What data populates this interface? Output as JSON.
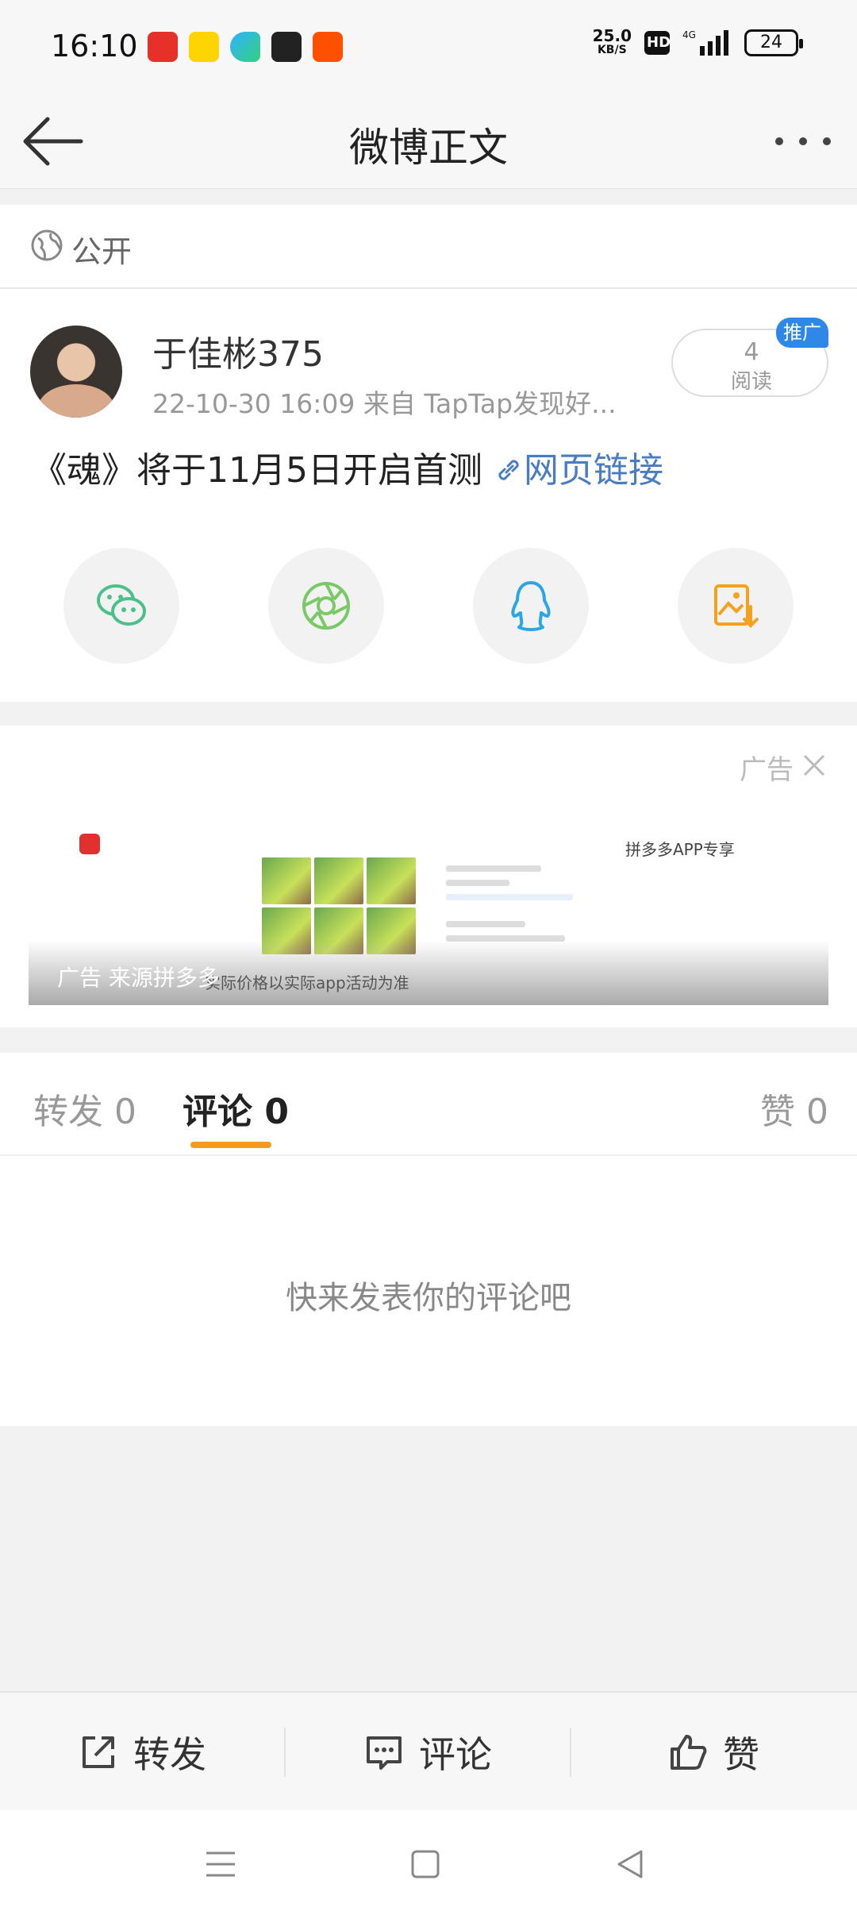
{
  "status_bar": {
    "time": "16:10",
    "net_speed_value": "25.0",
    "net_speed_unit": "KB/S",
    "hd": "HD",
    "signal": "4G",
    "battery": "24",
    "app_icons": [
      {
        "name": "toutiao-icon",
        "color": "#e6312b"
      },
      {
        "name": "yy-icon",
        "color": "#ffd400"
      },
      {
        "name": "video-icon",
        "color": "#2fb2ff"
      },
      {
        "name": "news-icon",
        "color": "#222222"
      },
      {
        "name": "taobao-icon",
        "color": "#ff5000"
      }
    ]
  },
  "nav": {
    "title": "微博正文"
  },
  "visibility": {
    "label": "公开"
  },
  "post": {
    "username": "于佳彬375",
    "meta": "22-10-30 16:09   来自 TapTap发现好...",
    "read_count": "4",
    "read_label": "阅读",
    "promo_badge": "推广",
    "text": "《魂》将于11月5日开启首测",
    "link_text": "网页链接"
  },
  "share": [
    {
      "name": "wechat-share-button",
      "color": "#4bc08a"
    },
    {
      "name": "moments-share-button",
      "color": "#79c966"
    },
    {
      "name": "qq-share-button",
      "color": "#2aa6e6"
    },
    {
      "name": "save-image-button",
      "color": "#f4a21e"
    }
  ],
  "ad": {
    "label": "广告",
    "source": "广告 来源拼多多",
    "note": "实际价格以实际app活动为准",
    "tag": "拼多多APP专享"
  },
  "tabs": {
    "repost": "转发 0",
    "comment": "评论 0",
    "like": "赞 0"
  },
  "empty": {
    "text": "快来发表你的评论吧"
  },
  "actions": {
    "repost": "转发",
    "comment": "评论",
    "like": "赞"
  },
  "colors": {
    "accent_orange": "#f39a1f",
    "link_blue": "#4a7cc2",
    "promo_blue": "#2f88e8"
  }
}
